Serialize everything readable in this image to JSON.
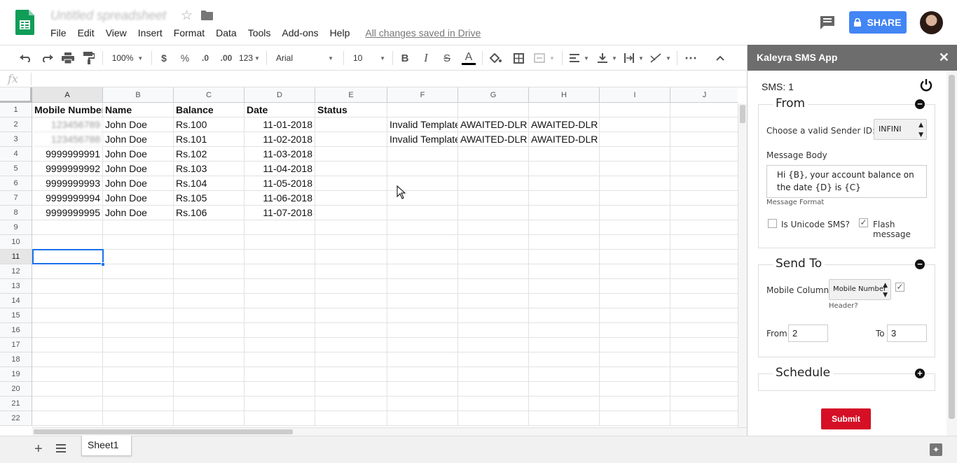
{
  "header": {
    "title": "Untitled spreadsheet",
    "menus": [
      "File",
      "Edit",
      "View",
      "Insert",
      "Format",
      "Data",
      "Tools",
      "Add-ons",
      "Help"
    ],
    "saved_status": "All changes saved in Drive",
    "share_label": "SHARE",
    "brand_color": "#0f9d58",
    "share_color": "#4285f4"
  },
  "toolbar": {
    "zoom": "100%",
    "currency": "$",
    "percent": "%",
    "decrease_decimal": ".0",
    "increase_decimal": ".00",
    "number_format": "123",
    "font": "Arial",
    "font_size": "10",
    "bold": "B",
    "italic": "I",
    "strikethrough": "S",
    "text_color": "A",
    "more": "⋯"
  },
  "formula_bar": {
    "fx": "fx",
    "value": ""
  },
  "grid": {
    "columns": [
      "A",
      "B",
      "C",
      "D",
      "E",
      "F",
      "G",
      "H",
      "I",
      "J"
    ],
    "rows": [
      "1",
      "2",
      "3",
      "4",
      "5",
      "6",
      "7",
      "8",
      "9",
      "10",
      "11",
      "12",
      "13",
      "14",
      "15",
      "16",
      "17",
      "18",
      "19",
      "20",
      "21",
      "22"
    ],
    "selected_cell": "A11",
    "data": [
      [
        "Mobile Number",
        "Name",
        "Balance",
        "Date",
        "Status",
        "",
        "",
        ""
      ],
      [
        "123456789",
        "John Doe",
        "Rs.100",
        "11-01-2018",
        "",
        "Invalid Template",
        "AWAITED-DLR",
        "AWAITED-DLR"
      ],
      [
        "123456788",
        "John Doe",
        "Rs.101",
        "11-02-2018",
        "",
        "Invalid Template",
        "AWAITED-DLR",
        "AWAITED-DLR"
      ],
      [
        "9999999991",
        "John Doe",
        "Rs.102",
        "11-03-2018",
        "",
        "",
        "",
        ""
      ],
      [
        "9999999992",
        "John Doe",
        "Rs.103",
        "11-04-2018",
        "",
        "",
        "",
        ""
      ],
      [
        "9999999993",
        "John Doe",
        "Rs.104",
        "11-05-2018",
        "",
        "",
        "",
        ""
      ],
      [
        "9999999994",
        "John Doe",
        "Rs.105",
        "11-06-2018",
        "",
        "",
        "",
        ""
      ],
      [
        "9999999995",
        "John Doe",
        "Rs.106",
        "11-07-2018",
        "",
        "",
        "",
        ""
      ]
    ]
  },
  "bottom": {
    "sheet_name": "Sheet1",
    "add_label": "+"
  },
  "sidebar": {
    "title": "Kaleyra SMS App",
    "close": "✕",
    "sms_count": "SMS: 1",
    "from": {
      "legend": "From",
      "sender_label": "Choose a valid Sender ID:",
      "sender_value": "INFINI",
      "body_label": "Message Body",
      "body_text": "Hi {B}, your account balance on the date {D} is {C}",
      "format_label": "Message Format",
      "unicode_label": "Is Unicode SMS?",
      "unicode_checked": false,
      "flash_label": "Flash message",
      "flash_checked": true
    },
    "send_to": {
      "legend": "Send To",
      "mobile_label": "Mobile Column:",
      "mobile_value": "Mobile Number",
      "header_label": "Header?",
      "header_checked": true,
      "from_label": "From",
      "from_value": "2",
      "to_label": "To",
      "to_value": "3"
    },
    "schedule": {
      "legend": "Schedule"
    },
    "submit_label": "Submit",
    "submit_color": "#d50f25"
  }
}
